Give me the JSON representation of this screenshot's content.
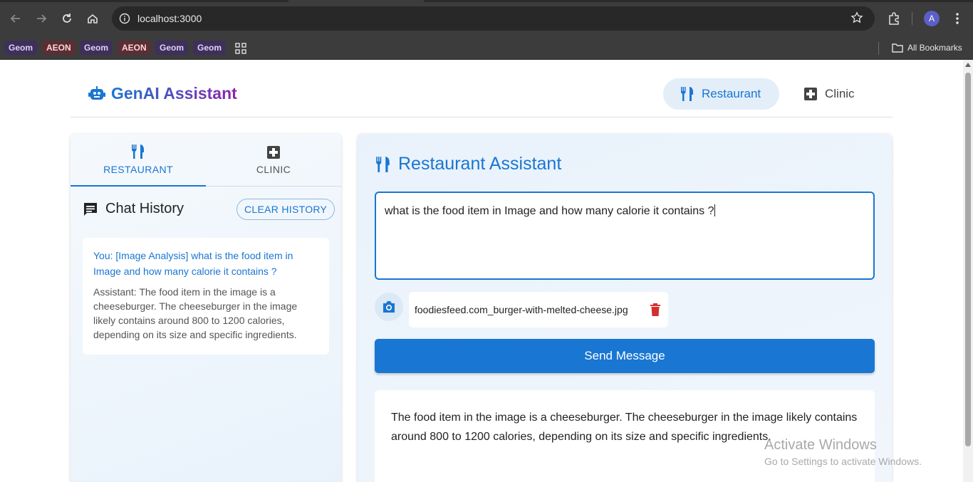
{
  "browser": {
    "url": "localhost:3000",
    "profile_initial": "A",
    "bookmarks": [
      "Geom",
      "AEON",
      "Geom",
      "AEON",
      "Geom",
      "Geom"
    ],
    "all_bookmarks_label": "All Bookmarks"
  },
  "header": {
    "brand_title": "GenAI Assistant",
    "nav": [
      {
        "label": "Restaurant",
        "active": true
      },
      {
        "label": "Clinic",
        "active": false
      }
    ]
  },
  "sidebar": {
    "tabs": [
      {
        "label": "RESTAURANT",
        "active": true
      },
      {
        "label": "CLINIC",
        "active": false
      }
    ],
    "history_title": "Chat History",
    "clear_label": "CLEAR HISTORY",
    "history": [
      {
        "you": "You: [Image Analysis] what is the food item in Image and how many calorie it contains ?",
        "assistant": "Assistant: The food item in the image is a cheeseburger. The cheeseburger in the image likely contains around 800 to 1200 calories, depending on its size and specific ingredients."
      }
    ]
  },
  "main": {
    "title": "Restaurant Assistant",
    "query": "what is the food item in Image and how many calorie it contains ?",
    "file_name": "foodiesfeed.com_burger-with-melted-cheese.jpg",
    "send_label": "Send Message",
    "response": "The food item in the image is a cheeseburger. The cheeseburger in the image likely contains around 800 to 1200 calories, depending on its size and specific ingredients."
  },
  "watermark": {
    "line1": "Activate Windows",
    "line2": "Go to Settings to activate Windows."
  },
  "colors": {
    "primary": "#1976d2",
    "brand_gradient_end": "#8e24aa",
    "delete": "#d32f2f"
  }
}
